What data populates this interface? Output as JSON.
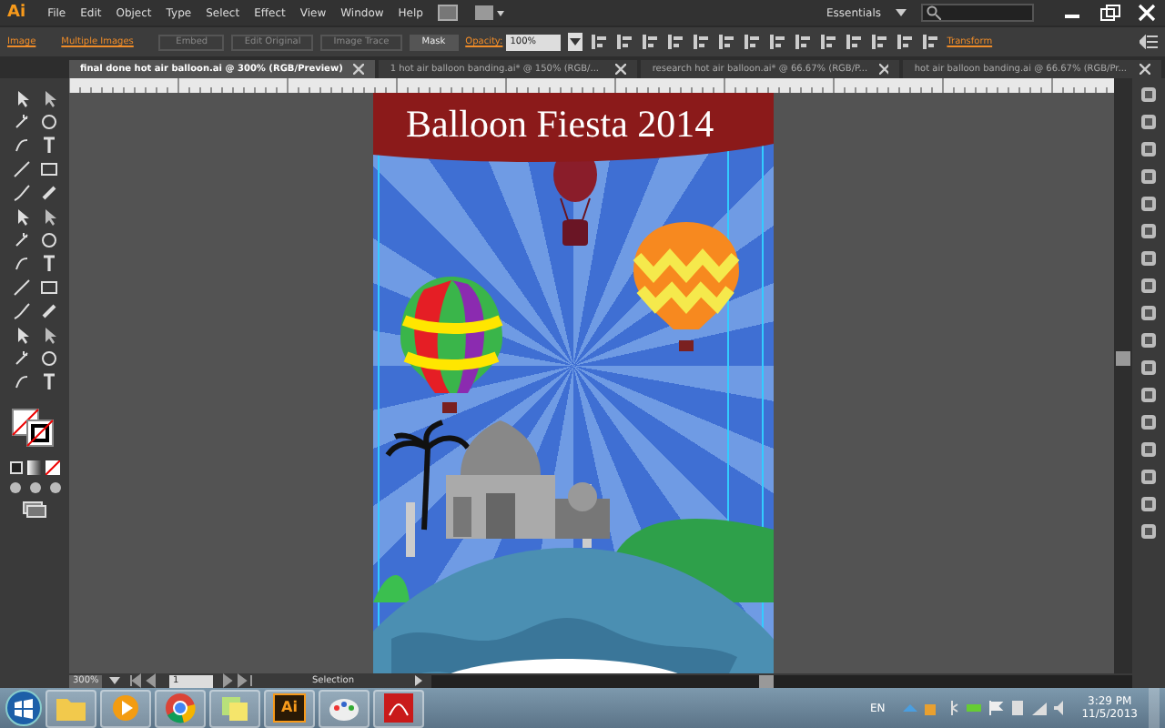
{
  "app": {
    "logo": "Ai"
  },
  "menu": [
    "File",
    "Edit",
    "Object",
    "Type",
    "Select",
    "Effect",
    "View",
    "Window",
    "Help"
  ],
  "workspace": {
    "label": "Essentials"
  },
  "control_bar": [
    {
      "kind": "link",
      "label": "Image"
    },
    {
      "kind": "link",
      "label": "Multiple Images"
    },
    {
      "kind": "button",
      "label": "Embed",
      "disabled": true
    },
    {
      "kind": "button",
      "label": "Edit Original",
      "disabled": true
    },
    {
      "kind": "button",
      "label": "Image Trace",
      "disabled": true
    },
    {
      "kind": "button",
      "label": "Mask",
      "disabled": false
    },
    {
      "kind": "link",
      "label": "Opacity:"
    },
    {
      "kind": "field",
      "label": "100%"
    },
    {
      "kind": "icons"
    },
    {
      "kind": "link",
      "label": "Transform"
    }
  ],
  "tabs": [
    {
      "label": "final done hot air balloon.ai @ 300% (RGB/Preview)",
      "selected": true
    },
    {
      "label": "1 hot air balloon banding.ai* @ 150% (RGB/...",
      "selected": false
    },
    {
      "label": "research hot air balloon.ai* @ 66.67% (RGB/P...",
      "selected": false
    },
    {
      "label": "hot air balloon banding.ai @ 66.67% (RGB/Pr...",
      "selected": false
    }
  ],
  "artwork": {
    "banner_text": "Balloon Fiesta 2014"
  },
  "status_bar": {
    "zoom": "300%",
    "page": "1",
    "tool": "Selection"
  },
  "taskbar": {
    "apps": [
      {
        "kind": "folder"
      },
      {
        "kind": "media"
      },
      {
        "kind": "chrome"
      },
      {
        "kind": "notes"
      },
      {
        "kind": "illustrator",
        "label": "Ai"
      },
      {
        "kind": "paint"
      },
      {
        "kind": "pdf"
      }
    ],
    "language": "EN",
    "time": "3:29 PM",
    "date": "11/5/2013"
  }
}
